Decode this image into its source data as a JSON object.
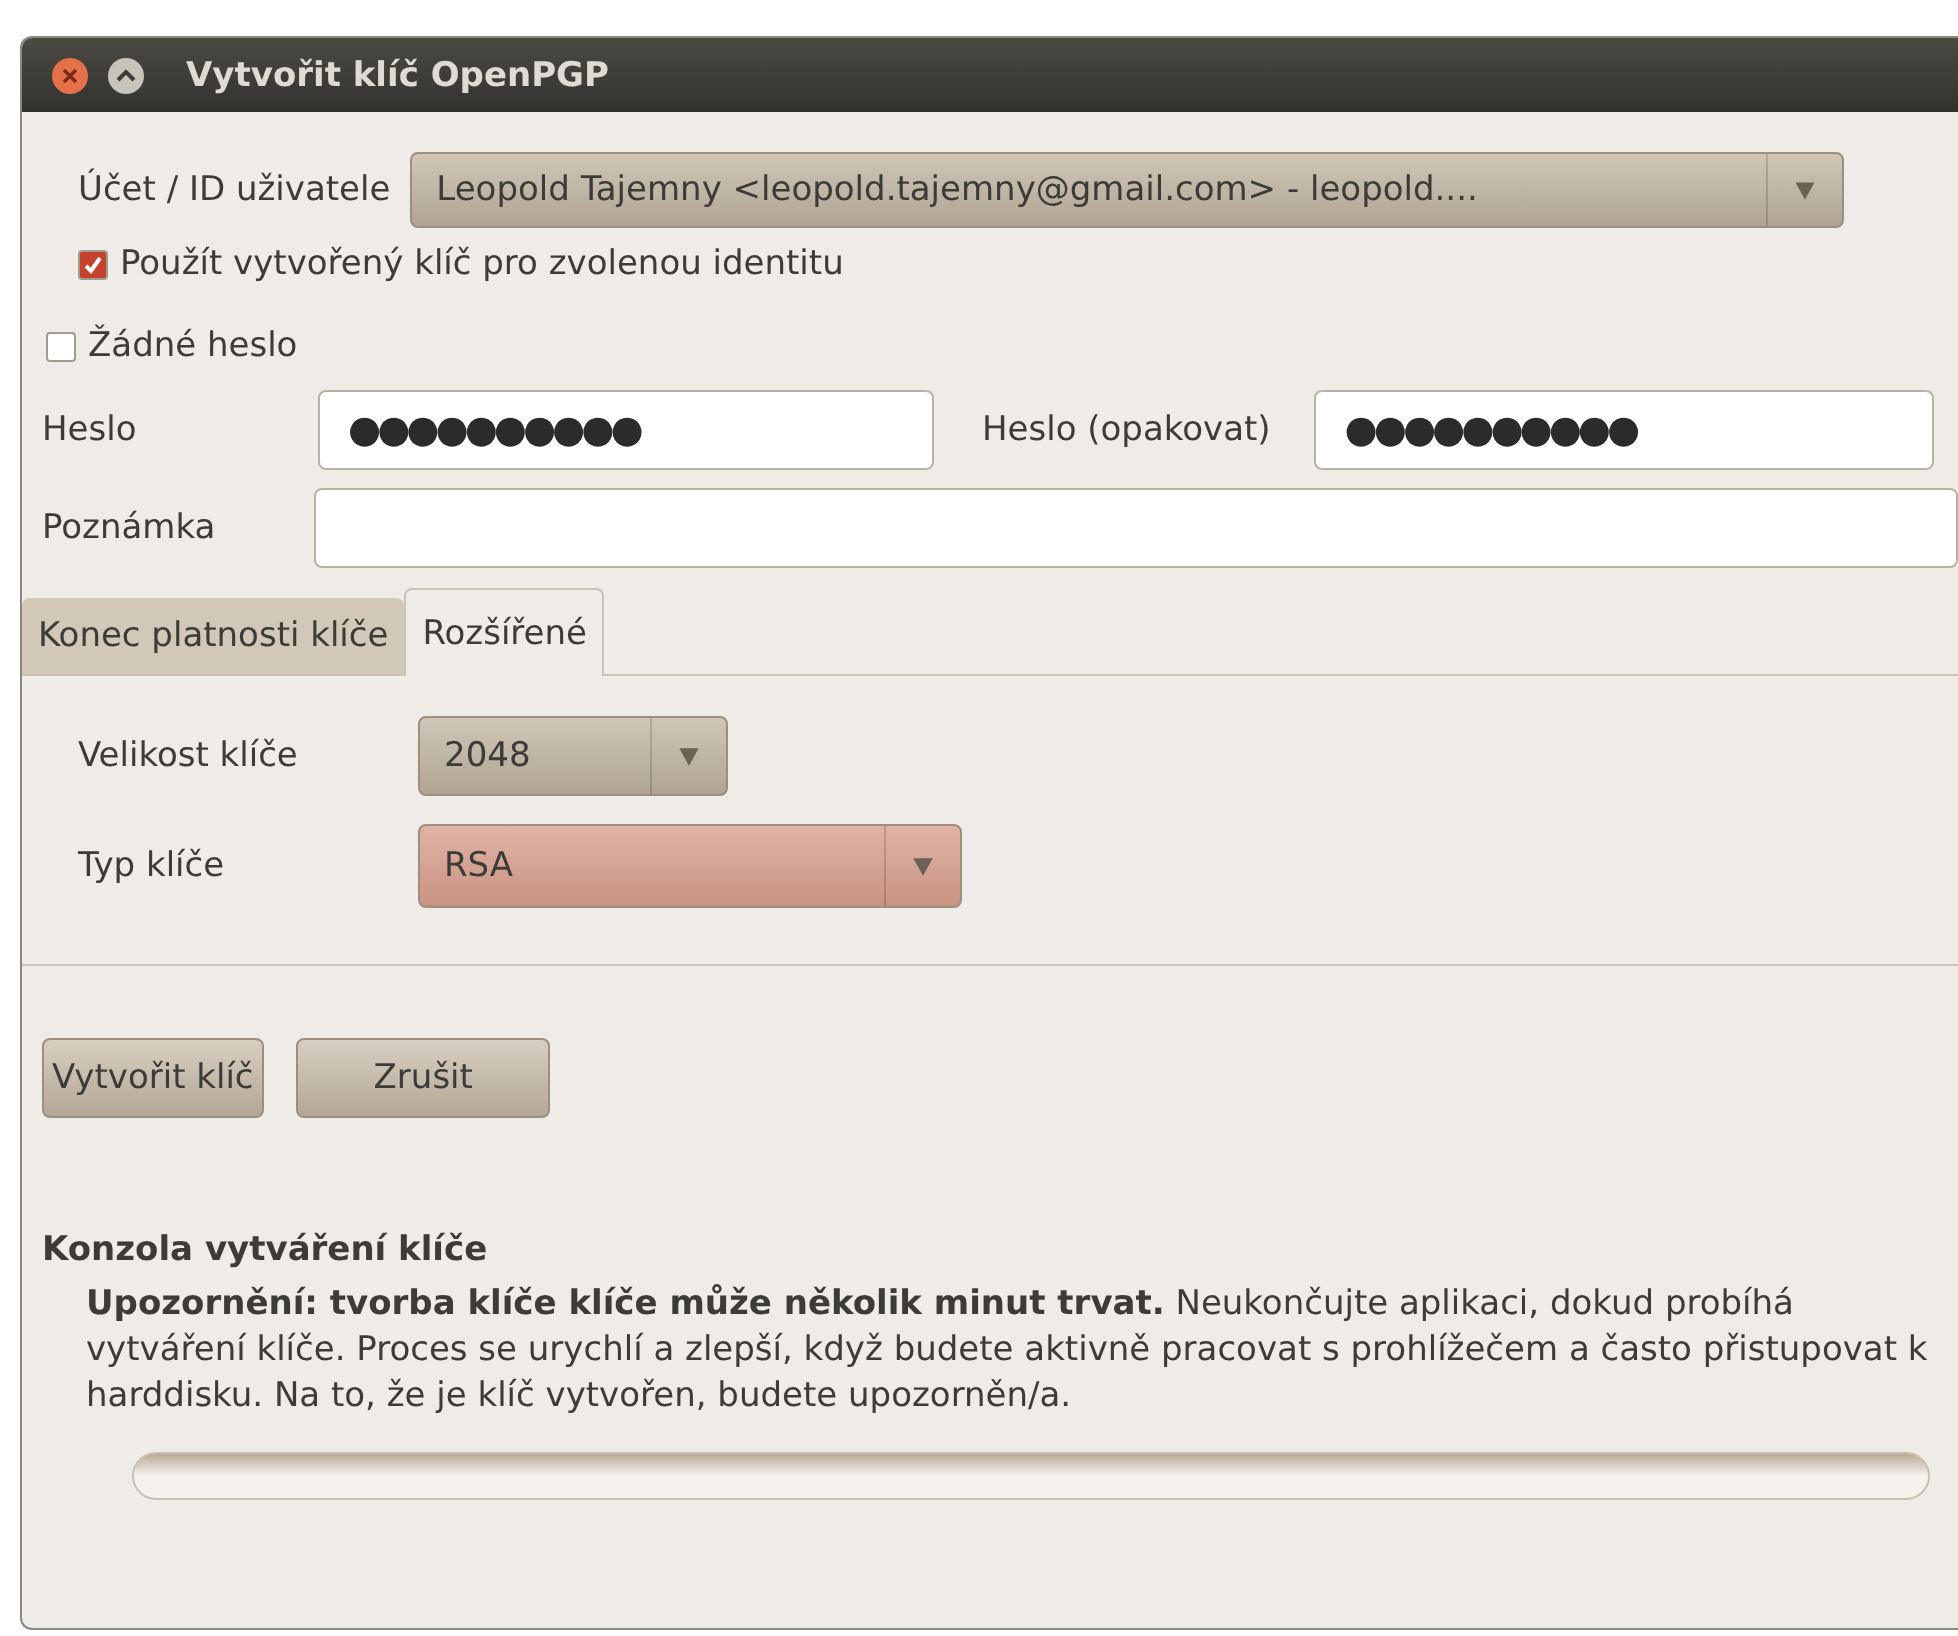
{
  "window": {
    "title": "Vytvořit klíč OpenPGP"
  },
  "account": {
    "label": "Účet / ID uživatele",
    "value": "Leopold Tajemny <leopold.tajemny@gmail.com> - leopold...."
  },
  "use_for_identity": {
    "label": "Použít vytvořený klíč pro zvolenou identitu",
    "checked": true
  },
  "no_password": {
    "label": "Žádné heslo",
    "checked": false
  },
  "password": {
    "label": "Heslo",
    "value": "●●●●●●●●●●"
  },
  "password_repeat": {
    "label": "Heslo (opakovat)",
    "value": "●●●●●●●●●●"
  },
  "comment": {
    "label": "Poznámka"
  },
  "tabs": [
    {
      "label": "Konec platnosti klíče",
      "selected": false
    },
    {
      "label": "Rozšířené",
      "selected": true
    }
  ],
  "key_size": {
    "label": "Velikost klíče",
    "value": "2048"
  },
  "key_type": {
    "label": "Typ klíče",
    "value": "RSA"
  },
  "buttons": [
    "Vytvořit klíč",
    "Zrušit"
  ],
  "console": {
    "heading": "Konzola vytváření klíče",
    "text": "**Upozornění: tvorba klíče klíče může několik minut trvat.** Neukončujte aplikaci, dokud probíhá vytváření klíče. Proces se urychlí a zlepší, když budete aktivně pracovat s prohlížečem a často přistupovat k harddisku. Na to, že je klíč vytvořen, budete upozorněn/a.",
    "level": 0
  }
}
